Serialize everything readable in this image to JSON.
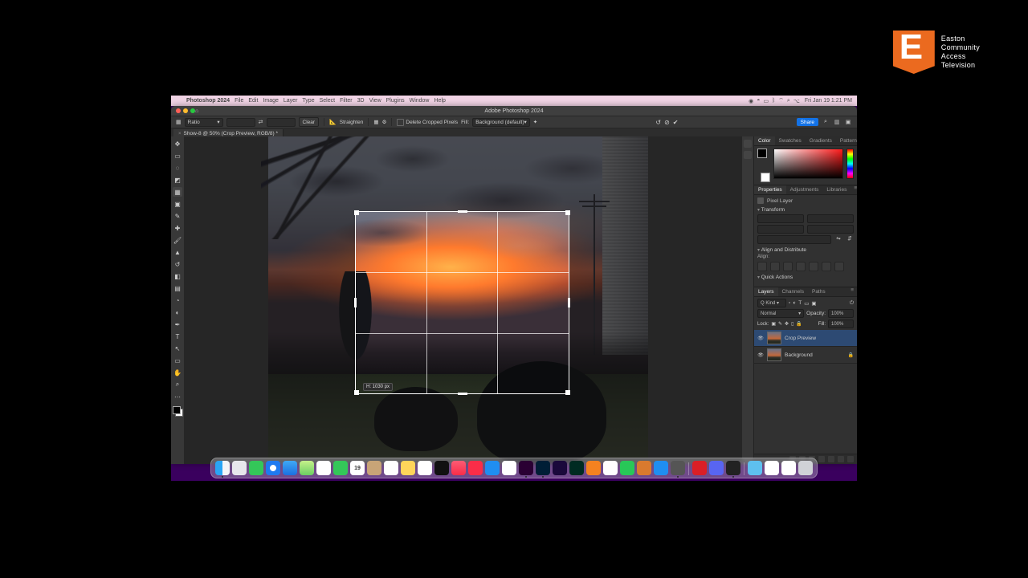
{
  "watermark": {
    "l1": "Easton",
    "l2": "Community",
    "l3": "Access",
    "l4": "Television"
  },
  "menubar": {
    "app": "Photoshop 2024",
    "items": [
      "File",
      "Edit",
      "Image",
      "Layer",
      "Type",
      "Select",
      "Filter",
      "3D",
      "View",
      "Plugins",
      "Window",
      "Help"
    ],
    "clock": "Fri Jan 19  1:21 PM"
  },
  "window": {
    "title": "Adobe Photoshop 2024"
  },
  "options": {
    "ratio_label": "Ratio",
    "ratio_w": "",
    "ratio_h": "",
    "clear": "Clear",
    "straighten": "Straighten",
    "delete_cropped": "Delete Cropped Pixels",
    "fill": "Fill:",
    "fill_value": "Background (default)",
    "share": "Share"
  },
  "tab": {
    "title": "Show-8 @ 50% (Crop Preview, RGB/8) *"
  },
  "crop_tooltip": "H: 1030 px",
  "panels": {
    "color_tabs": [
      "Color",
      "Swatches",
      "Gradients",
      "Patterns"
    ],
    "props_tabs": [
      "Properties",
      "Adjustments",
      "Libraries"
    ],
    "props_type": "Pixel Layer",
    "sect_transform": "Transform",
    "sect_align": "Align and Distribute",
    "align_label": "Align:",
    "sect_quick": "Quick Actions",
    "layers_tabs": [
      "Layers",
      "Channels",
      "Paths"
    ],
    "blend": "Normal",
    "opacity_label": "Opacity:",
    "opacity": "100%",
    "lock_label": "Lock:",
    "fill_label": "Fill:",
    "fill_pct": "100%",
    "layers": [
      {
        "name": "Crop Preview"
      },
      {
        "name": "Background"
      }
    ]
  },
  "dock": {
    "cal_day": "19"
  }
}
